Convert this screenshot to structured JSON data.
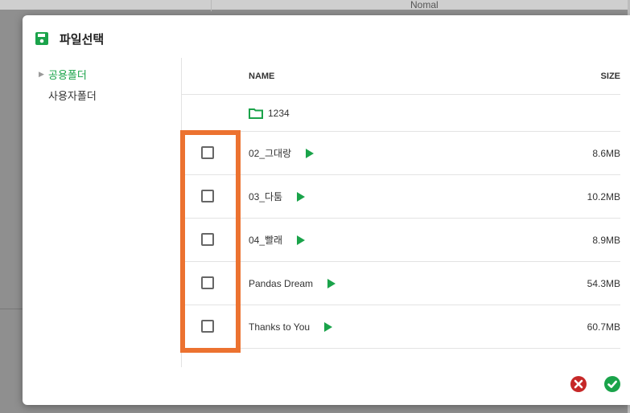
{
  "background": {
    "partial_text": "Nomal"
  },
  "dialog": {
    "title": "파일선택",
    "save_icon": "save-icon",
    "accent_color": "#1aa34a",
    "highlight_color": "#ec7230"
  },
  "tree": {
    "items": [
      {
        "label": "공용폴더",
        "active": true,
        "icon": "triangle-right-icon"
      },
      {
        "label": "사용자폴더",
        "active": false
      }
    ]
  },
  "table": {
    "columns": {
      "name": "NAME",
      "size": "SIZE"
    },
    "folder": {
      "name": "1234",
      "icon": "folder-icon"
    },
    "files": [
      {
        "name": "02_그대랑",
        "size": "8.6MB"
      },
      {
        "name": "03_다툼",
        "size": "10.2MB"
      },
      {
        "name": "04_빨래",
        "size": "8.9MB"
      },
      {
        "name": "Pandas Dream",
        "size": "54.3MB"
      },
      {
        "name": "Thanks to You",
        "size": "60.7MB"
      }
    ]
  },
  "footer": {
    "cancel_icon": "cancel-icon",
    "confirm_icon": "confirm-icon",
    "cancel_color": "#c62828",
    "confirm_color": "#1aa34a"
  }
}
